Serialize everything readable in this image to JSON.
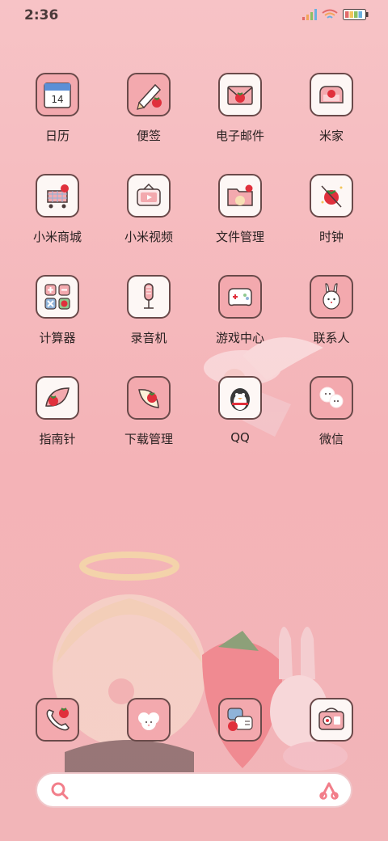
{
  "status_bar": {
    "time": "2:36",
    "icons": [
      "signal-icon",
      "wifi-icon",
      "battery-icon"
    ]
  },
  "apps": [
    {
      "label": "日历",
      "icon": "calendar-icon",
      "calendar_day": "14"
    },
    {
      "label": "便签",
      "icon": "notes-pencil-icon"
    },
    {
      "label": "电子邮件",
      "icon": "mail-envelope-icon"
    },
    {
      "label": "米家",
      "icon": "sofa-icon"
    },
    {
      "label": "小米商城",
      "icon": "shopping-cart-icon"
    },
    {
      "label": "小米视频",
      "icon": "tv-play-icon"
    },
    {
      "label": "文件管理",
      "icon": "folder-icon"
    },
    {
      "label": "时钟",
      "icon": "clock-strawberry-icon"
    },
    {
      "label": "计算器",
      "icon": "calculator-icon"
    },
    {
      "label": "录音机",
      "icon": "microphone-icon"
    },
    {
      "label": "游戏中心",
      "icon": "gamepad-icon"
    },
    {
      "label": "联系人",
      "icon": "bunny-icon"
    },
    {
      "label": "指南针",
      "icon": "compass-leaf-icon"
    },
    {
      "label": "下载管理",
      "icon": "download-leaf-icon"
    },
    {
      "label": "QQ",
      "icon": "penguin-icon"
    },
    {
      "label": "微信",
      "icon": "chat-bubbles-icon"
    }
  ],
  "dock": [
    {
      "icon": "phone-icon"
    },
    {
      "icon": "sheep-messages-icon"
    },
    {
      "icon": "chat-strawberry-icon"
    },
    {
      "icon": "camera-radio-icon"
    }
  ],
  "search": {
    "placeholder": ""
  },
  "colors": {
    "accent": "#f3a9ae",
    "background": "#f6bcc0",
    "border": "#6a4a4a",
    "strawberry": "#e0303c"
  }
}
